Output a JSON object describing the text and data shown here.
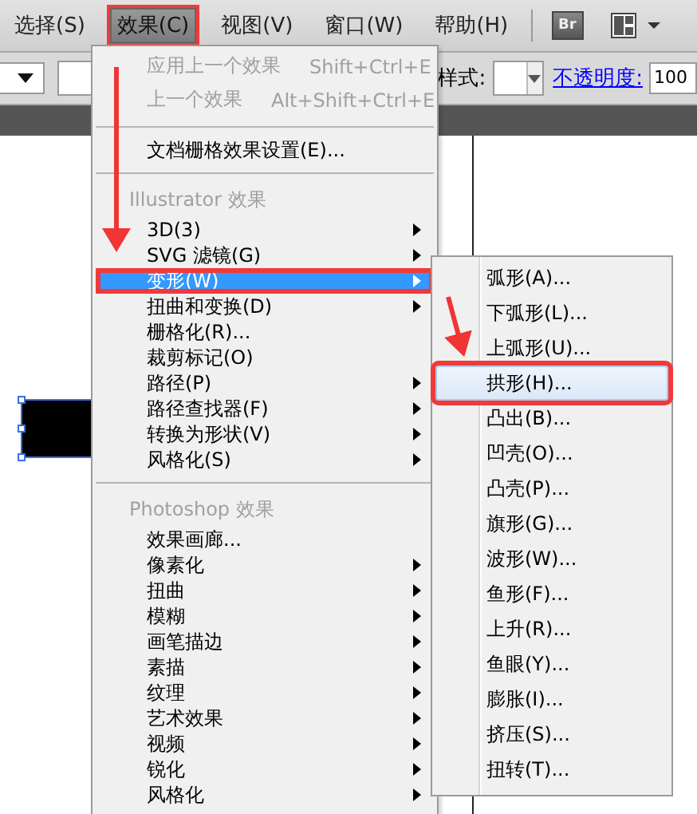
{
  "menubar": [
    {
      "label": "选择(S)",
      "open": false,
      "callout": false
    },
    {
      "label": "效果(C)",
      "open": true,
      "callout": true
    },
    {
      "label": "视图(V)",
      "open": false,
      "callout": false
    },
    {
      "label": "窗口(W)",
      "open": false,
      "callout": false
    },
    {
      "label": "帮助(H)",
      "open": false,
      "callout": false
    }
  ],
  "bridge_button": "Br",
  "toolbar": {
    "style_label": "样式:",
    "opacity_link": "不透明度:",
    "opacity_value": "100"
  },
  "menu": [
    {
      "kind": "item",
      "label": "应用上一个效果",
      "shortcut": "Shift+Ctrl+E",
      "disabled": true,
      "has_submenu": false,
      "selected": false,
      "callout": false
    },
    {
      "kind": "item",
      "label": "上一个效果",
      "shortcut": "Alt+Shift+Ctrl+E",
      "disabled": true,
      "has_submenu": false,
      "selected": false,
      "callout": false
    },
    {
      "kind": "separator"
    },
    {
      "kind": "item",
      "label": "文档栅格效果设置(E)...",
      "disabled": false,
      "has_submenu": false,
      "selected": false,
      "callout": false
    },
    {
      "kind": "separator"
    },
    {
      "kind": "header",
      "label": "Illustrator 效果"
    },
    {
      "kind": "item",
      "label": "3D(3)",
      "disabled": false,
      "has_submenu": true,
      "selected": false,
      "callout": false
    },
    {
      "kind": "item",
      "label": "SVG 滤镜(G)",
      "disabled": false,
      "has_submenu": true,
      "selected": false,
      "callout": false
    },
    {
      "kind": "item",
      "label": "变形(W)",
      "disabled": false,
      "has_submenu": true,
      "selected": true,
      "callout": true
    },
    {
      "kind": "item",
      "label": "扭曲和变换(D)",
      "disabled": false,
      "has_submenu": true,
      "selected": false,
      "callout": false
    },
    {
      "kind": "item",
      "label": "栅格化(R)...",
      "disabled": false,
      "has_submenu": false,
      "selected": false,
      "callout": false
    },
    {
      "kind": "item",
      "label": "裁剪标记(O)",
      "disabled": false,
      "has_submenu": false,
      "selected": false,
      "callout": false
    },
    {
      "kind": "item",
      "label": "路径(P)",
      "disabled": false,
      "has_submenu": true,
      "selected": false,
      "callout": false
    },
    {
      "kind": "item",
      "label": "路径查找器(F)",
      "disabled": false,
      "has_submenu": true,
      "selected": false,
      "callout": false
    },
    {
      "kind": "item",
      "label": "转换为形状(V)",
      "disabled": false,
      "has_submenu": true,
      "selected": false,
      "callout": false
    },
    {
      "kind": "item",
      "label": "风格化(S)",
      "disabled": false,
      "has_submenu": true,
      "selected": false,
      "callout": false
    },
    {
      "kind": "separator"
    },
    {
      "kind": "header",
      "label": "Photoshop 效果"
    },
    {
      "kind": "item",
      "label": "效果画廊...",
      "disabled": false,
      "has_submenu": false,
      "selected": false,
      "callout": false
    },
    {
      "kind": "item",
      "label": "像素化",
      "disabled": false,
      "has_submenu": true,
      "selected": false,
      "callout": false
    },
    {
      "kind": "item",
      "label": "扭曲",
      "disabled": false,
      "has_submenu": true,
      "selected": false,
      "callout": false
    },
    {
      "kind": "item",
      "label": "模糊",
      "disabled": false,
      "has_submenu": true,
      "selected": false,
      "callout": false
    },
    {
      "kind": "item",
      "label": "画笔描边",
      "disabled": false,
      "has_submenu": true,
      "selected": false,
      "callout": false
    },
    {
      "kind": "item",
      "label": "素描",
      "disabled": false,
      "has_submenu": true,
      "selected": false,
      "callout": false
    },
    {
      "kind": "item",
      "label": "纹理",
      "disabled": false,
      "has_submenu": true,
      "selected": false,
      "callout": false
    },
    {
      "kind": "item",
      "label": "艺术效果",
      "disabled": false,
      "has_submenu": true,
      "selected": false,
      "callout": false
    },
    {
      "kind": "item",
      "label": "视频",
      "disabled": false,
      "has_submenu": true,
      "selected": false,
      "callout": false
    },
    {
      "kind": "item",
      "label": "锐化",
      "disabled": false,
      "has_submenu": true,
      "selected": false,
      "callout": false
    },
    {
      "kind": "item",
      "label": "风格化",
      "disabled": false,
      "has_submenu": true,
      "selected": false,
      "callout": false
    }
  ],
  "submenu": [
    {
      "label": "弧形(A)...",
      "selected": false,
      "callout": false
    },
    {
      "label": "下弧形(L)...",
      "selected": false,
      "callout": false
    },
    {
      "label": "上弧形(U)...",
      "selected": false,
      "callout": false
    },
    {
      "label": "拱形(H)...",
      "selected": true,
      "callout": true
    },
    {
      "label": "凸出(B)...",
      "selected": false,
      "callout": false
    },
    {
      "label": "凹壳(O)...",
      "selected": false,
      "callout": false
    },
    {
      "label": "凸壳(P)...",
      "selected": false,
      "callout": false
    },
    {
      "label": "旗形(G)...",
      "selected": false,
      "callout": false
    },
    {
      "label": "波形(W)...",
      "selected": false,
      "callout": false
    },
    {
      "label": "鱼形(F)...",
      "selected": false,
      "callout": false
    },
    {
      "label": "上升(R)...",
      "selected": false,
      "callout": false
    },
    {
      "label": "鱼眼(Y)...",
      "selected": false,
      "callout": false
    },
    {
      "label": "膨胀(I)...",
      "selected": false,
      "callout": false
    },
    {
      "label": "挤压(S)...",
      "selected": false,
      "callout": false
    },
    {
      "label": "扭转(T)...",
      "selected": false,
      "callout": false
    }
  ]
}
